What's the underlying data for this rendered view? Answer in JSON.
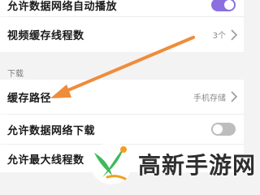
{
  "rows": {
    "autoplay": {
      "label": "允许数据网络自动播放",
      "toggle_on": true
    },
    "video_threads": {
      "label": "视频缓存线程数",
      "value": "3个"
    },
    "cache_path": {
      "label": "缓存路径",
      "value": "手机存储"
    },
    "allow_download": {
      "label": "允许数据网络下载",
      "toggle_on": false
    },
    "max_threads": {
      "label": "允许最大线程数"
    }
  },
  "section": {
    "download_header": "下载"
  },
  "watermark": {
    "text": "高新手游网"
  },
  "colors": {
    "toggle_on": "#8b6fe0",
    "toggle_off": "#bdbdbd",
    "arrow": "#ef8c3a",
    "logo_green": "#3dbb5a",
    "logo_orange": "#f0a020"
  }
}
